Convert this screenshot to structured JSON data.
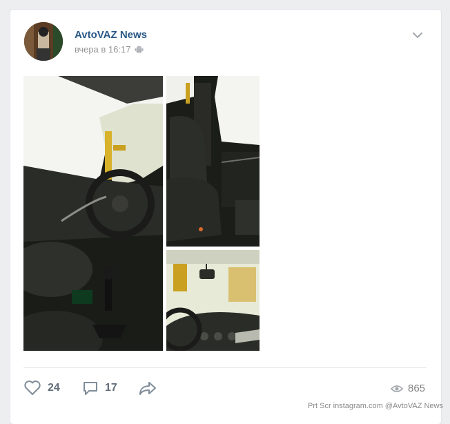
{
  "post": {
    "author": "AvtoVAZ News",
    "time": "вчера в 16:17",
    "platform_icon": "android-icon"
  },
  "photos": [
    {
      "alt": "Car interior: steering wheel and gear shift"
    },
    {
      "alt": "Car interior: seats and door panel"
    },
    {
      "alt": "Car interior: dashboard and windshield"
    }
  ],
  "actions": {
    "likes": "24",
    "comments": "17",
    "views": "865"
  },
  "watermark": "Prt Scr instagram.com  @AvtoVAZ News",
  "colors": {
    "author": "#2a5885",
    "meta": "#939393",
    "background": "#edeef0"
  }
}
